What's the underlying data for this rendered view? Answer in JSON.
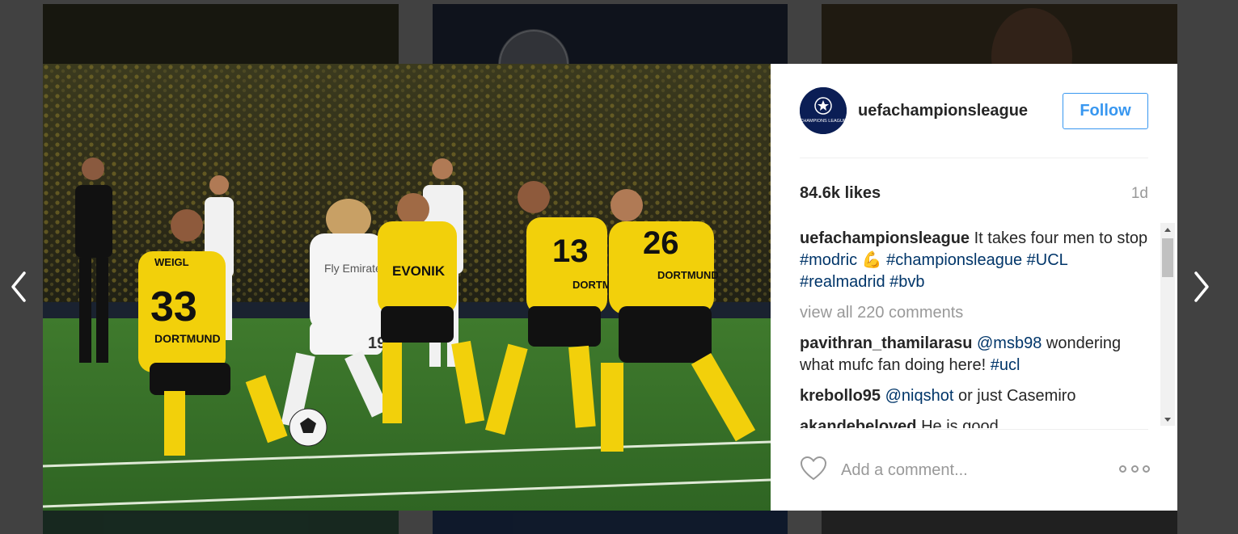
{
  "post": {
    "username": "uefachampionsleague",
    "follow_label": "Follow",
    "likes": "84.6k likes",
    "time": "1d",
    "avatar_text": "CHAMPIONS LEAGUE",
    "caption": {
      "user": "uefachampionsleague",
      "text_1": " It takes four men to stop ",
      "tag_1": "#modric",
      "emoji": "💪",
      "tag_2": "#championsleague",
      "tag_3": "#UCL",
      "tag_4": "#realmadrid",
      "tag_5": "#bvb"
    },
    "view_all": "view all 220 comments",
    "comments": [
      {
        "user": "pavithran_thamilarasu",
        "mention": "@msb98",
        "text": " wondering what mufc fan doing here! ",
        "tag": "#ucl"
      },
      {
        "user": "krebollo95",
        "mention": "@niqshot",
        "text": " or just Casemiro"
      },
      {
        "user": "akandebeloved",
        "text": " He is good"
      }
    ],
    "comment_placeholder": "Add a comment...",
    "photo_jerseys": {
      "player_1": "WEIGL",
      "player_1_no": "33",
      "player_1_club": "DORTMUND",
      "player_2_no": "19",
      "player_2_sponsor": "Fly Emirates",
      "player_3_sponsor": "EVONIK",
      "player_4_no": "13",
      "player_4_name": "DORTMUND",
      "player_5_no": "26",
      "player_5_name": "DORTMUND"
    }
  },
  "colors": {
    "accent": "#3897f0",
    "tag": "#003569",
    "muted": "#999999",
    "bvb_yellow": "#f2d00b"
  }
}
